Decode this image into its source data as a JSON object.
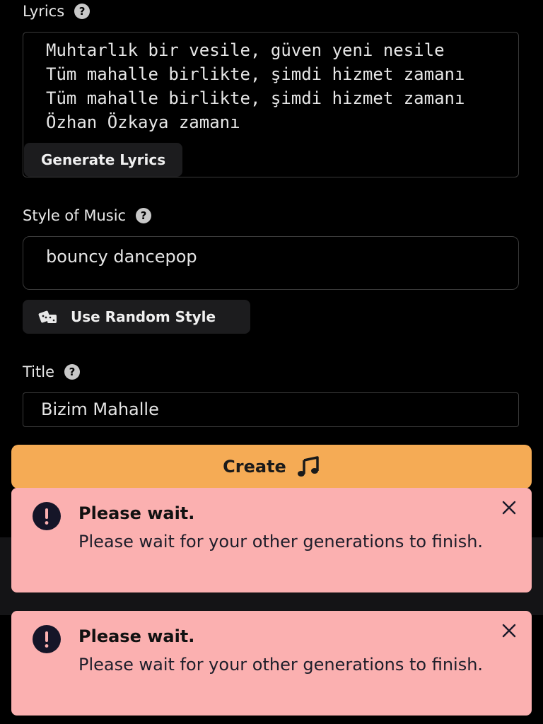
{
  "lyrics": {
    "label": "Lyrics",
    "help_glyph": "?",
    "lines": "Muhtarlık bir vesile, güven yeni nesile\nTüm mahalle birlikte, şimdi hizmet zamanı\nTüm mahalle birlikte, şimdi hizmet zamanı\nÖzhan Özkaya zamanı",
    "generate_label": "Generate Lyrics"
  },
  "style": {
    "label": "Style of Music",
    "help_glyph": "?",
    "value": "bouncy dancepop",
    "random_label": "Use Random Style"
  },
  "title": {
    "label": "Title",
    "help_glyph": "?",
    "value": "Bizim Mahalle"
  },
  "create": {
    "label": "Create",
    "icon": "music-note-icon"
  },
  "toasts": [
    {
      "title": "Please wait.",
      "message": "Please wait for your other generations to finish."
    },
    {
      "title": "Please wait.",
      "message": "Please wait for your other generations to finish."
    }
  ],
  "colors": {
    "background": "#000000",
    "accent": "#f5ab55",
    "toast_bg": "#fbb0b0",
    "button_bg": "#1c1c1e"
  }
}
